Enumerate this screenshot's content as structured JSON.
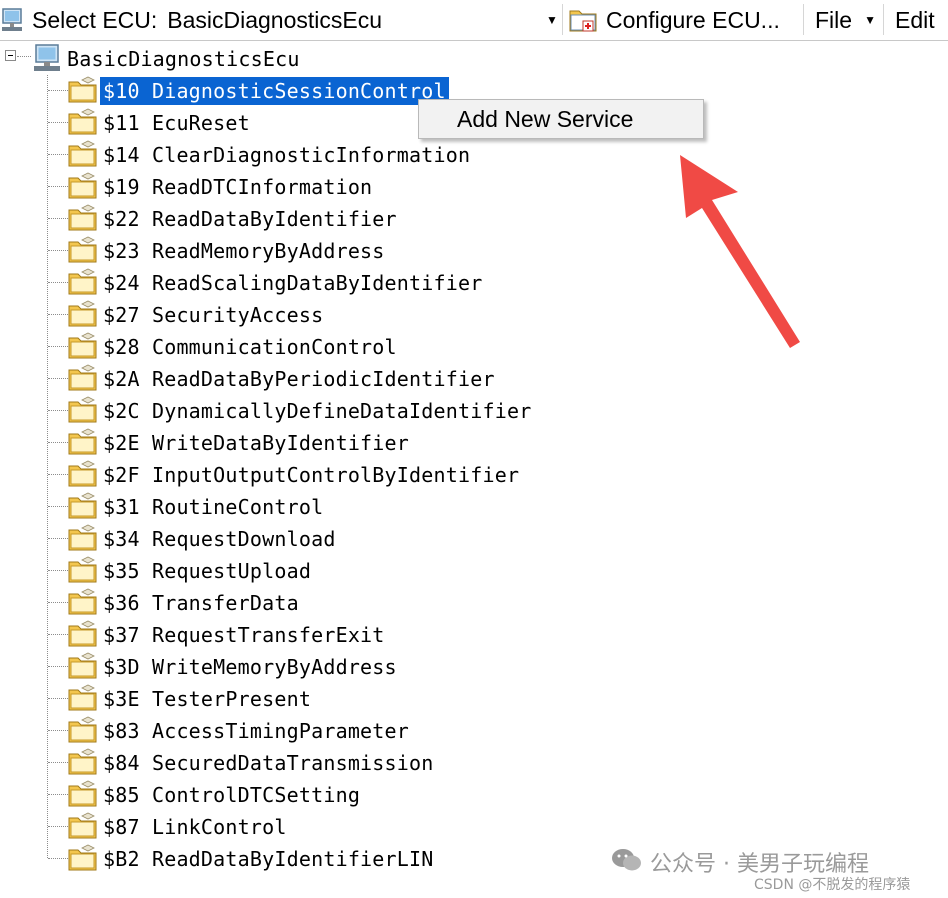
{
  "toolbar": {
    "select_ecu_label": "Select ECU:",
    "selected_ecu": "BasicDiagnosticsEcu",
    "configure_label": "Configure ECU...",
    "file_label": "File",
    "edit_label": "Edit"
  },
  "tree": {
    "root_label": "BasicDiagnosticsEcu",
    "items": [
      {
        "label": "$10 DiagnosticSessionControl",
        "selected": true
      },
      {
        "label": "$11 EcuReset"
      },
      {
        "label": "$14 ClearDiagnosticInformation"
      },
      {
        "label": "$19 ReadDTCInformation"
      },
      {
        "label": "$22 ReadDataByIdentifier"
      },
      {
        "label": "$23 ReadMemoryByAddress"
      },
      {
        "label": "$24 ReadScalingDataByIdentifier"
      },
      {
        "label": "$27 SecurityAccess"
      },
      {
        "label": "$28 CommunicationControl"
      },
      {
        "label": "$2A ReadDataByPeriodicIdentifier"
      },
      {
        "label": "$2C DynamicallyDefineDataIdentifier"
      },
      {
        "label": "$2E WriteDataByIdentifier"
      },
      {
        "label": "$2F InputOutputControlByIdentifier"
      },
      {
        "label": "$31 RoutineControl"
      },
      {
        "label": "$34 RequestDownload"
      },
      {
        "label": "$35 RequestUpload"
      },
      {
        "label": "$36 TransferData"
      },
      {
        "label": "$37 RequestTransferExit"
      },
      {
        "label": "$3D WriteMemoryByAddress"
      },
      {
        "label": "$3E TesterPresent"
      },
      {
        "label": "$83 AccessTimingParameter"
      },
      {
        "label": "$84 SecuredDataTransmission"
      },
      {
        "label": "$85 ControlDTCSetting"
      },
      {
        "label": "$87 LinkControl"
      },
      {
        "label": "$B2 ReadDataByIdentifierLIN"
      }
    ]
  },
  "context_menu": {
    "items": [
      "Add New Service"
    ]
  },
  "watermark": {
    "main": "公众号 · 美男子玩编程",
    "sub": "CSDN @不脱发的程序猿"
  },
  "colors": {
    "selection": "#0a64d2",
    "arrow": "#f04a45",
    "folder": "#f3c64e"
  }
}
